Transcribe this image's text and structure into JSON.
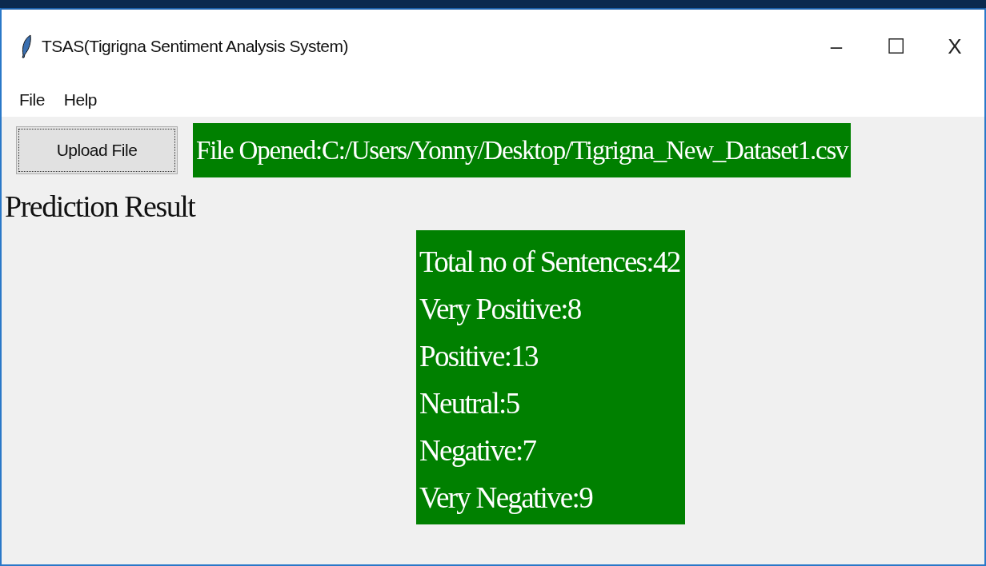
{
  "window": {
    "title": "TSAS(Tigrigna Sentiment Analysis System)",
    "controls": [
      "–",
      "☐",
      "X"
    ]
  },
  "menu": [
    "File",
    "Help"
  ],
  "upload_button": "Upload File",
  "file_status": "File Opened:C:/Users/Yonny/Desktop/Tigrigna_New_Dataset1.csv",
  "heading": "Prediction Result",
  "results": [
    "Total no of Sentences:42",
    "Very Positive:8",
    "Positive:13",
    "Neutral:5",
    "Negative:7",
    "Very Negative:9"
  ]
}
